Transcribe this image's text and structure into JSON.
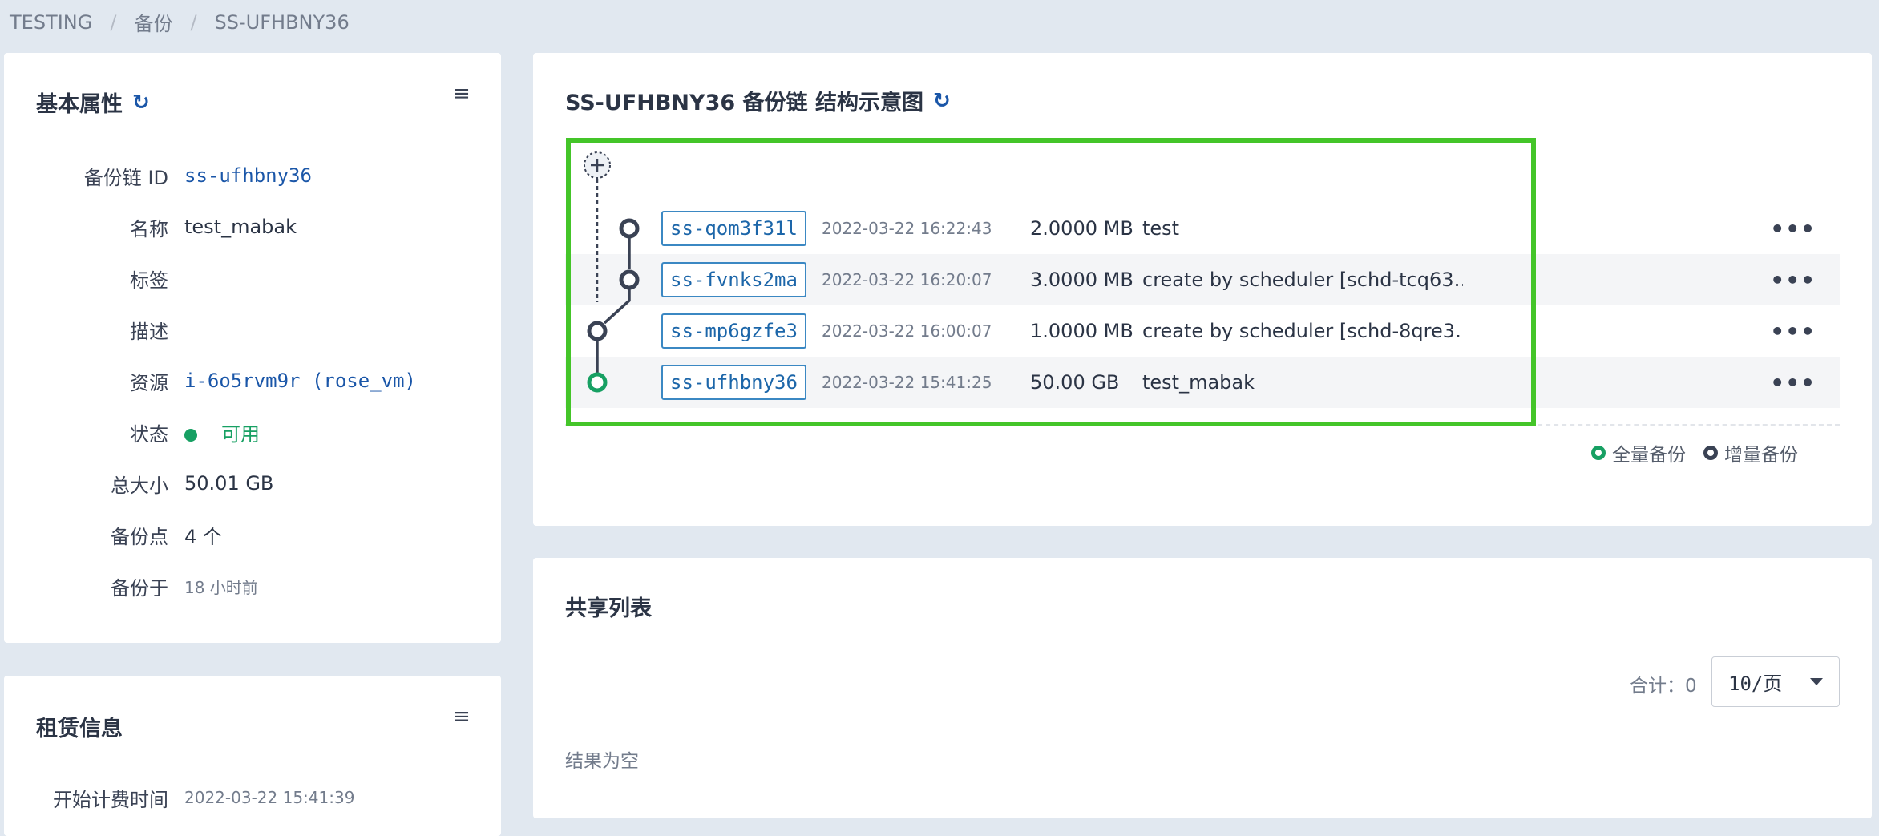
{
  "breadcrumb": [
    "TESTING",
    "备份",
    "SS-UFHBNY36"
  ],
  "basic": {
    "title": "基本属性",
    "rows": {
      "id": {
        "label": "备份链 ID",
        "value": "ss-ufhbny36"
      },
      "name": {
        "label": "名称",
        "value": "test_mabak"
      },
      "tags": {
        "label": "标签",
        "value": ""
      },
      "desc": {
        "label": "描述",
        "value": ""
      },
      "resource": {
        "label": "资源",
        "value": "i-6o5rvm9r (rose_vm)"
      },
      "status": {
        "label": "状态",
        "value": "可用"
      },
      "size": {
        "label": "总大小",
        "value": "50.01 GB"
      },
      "points": {
        "label": "备份点",
        "value": "4 个"
      },
      "backup_at": {
        "label": "备份于",
        "value": "18 小时前"
      }
    }
  },
  "lease": {
    "title": "租赁信息",
    "start_label": "开始计费时间",
    "start_value": "2022-03-22 15:41:39"
  },
  "chain": {
    "title": "SS-UFHBNY36 备份链 结构示意图",
    "snapshots": [
      {
        "id": "ss-qom3f31l",
        "time": "2022-03-22 16:22:43",
        "size": "2.0000 MB",
        "desc": "test",
        "type": "increment"
      },
      {
        "id": "ss-fvnks2ma",
        "time": "2022-03-22 16:20:07",
        "size": "3.0000 MB",
        "desc": "create by scheduler [schd-tcq63…",
        "type": "increment"
      },
      {
        "id": "ss-mp6gzfe3",
        "time": "2022-03-22 16:00:07",
        "size": "1.0000 MB",
        "desc": "create by scheduler [schd-8qre3…",
        "type": "increment"
      },
      {
        "id": "ss-ufhbny36",
        "time": "2022-03-22 15:41:25",
        "size": "50.00 GB",
        "desc": "test_mabak",
        "type": "full"
      }
    ],
    "more_label": "•••",
    "legend": {
      "full": "全量备份",
      "increment": "增量备份"
    }
  },
  "share": {
    "title": "共享列表",
    "total_label": "合计：0",
    "page_size": "10/页",
    "empty": "结果为空"
  },
  "colors": {
    "full": "#17a063",
    "increment": "#3a4254",
    "highlight": "#44c529",
    "link": "#1a56a8"
  },
  "icons": {
    "refresh": "refresh-icon",
    "menu": "menu-icon",
    "add": "add-icon",
    "more": "more-icon",
    "caret": "caret-down-icon"
  }
}
